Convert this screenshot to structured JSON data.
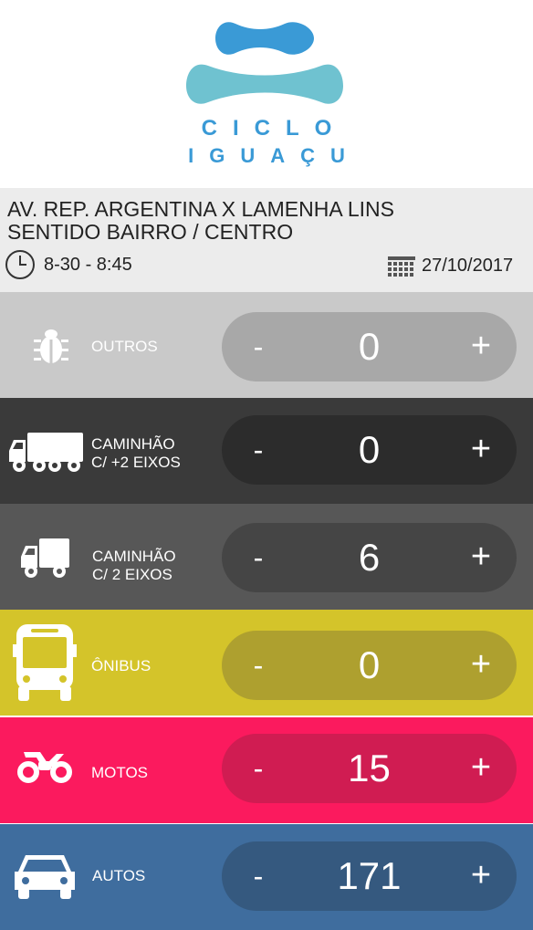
{
  "logo": {
    "line1": "CICLO",
    "line2": "IGUAÇU"
  },
  "location": {
    "line1": "AV. REP. ARGENTINA X LAMENHA LINS",
    "line2": "SENTIDO BAIRRO / CENTRO"
  },
  "time": {
    "range": "8-30 - 8:45",
    "icon": "clock-icon"
  },
  "date": {
    "value": "27/10/2017",
    "icon": "calendar-icon"
  },
  "counters": [
    {
      "label1": "OUTROS",
      "label2": "",
      "value": "0",
      "minus": "-",
      "plus": "+",
      "icon": "bug-icon",
      "bg": "#c9c9c9",
      "pill": "#a8a8a8"
    },
    {
      "label1": "CAMINHÃO",
      "label2": "C/ +2 EIXOS",
      "value": "0",
      "minus": "-",
      "plus": "+",
      "icon": "large-truck-icon",
      "bg": "#3a3a3a",
      "pill": "#2c2c2c"
    },
    {
      "label1": "CAMINHÃO",
      "label2": "C/ 2 EIXOS",
      "value": "6",
      "minus": "-",
      "plus": "+",
      "icon": "small-truck-icon",
      "bg": "#575757",
      "pill": "#454545"
    },
    {
      "label1": "ÔNIBUS",
      "label2": "",
      "value": "0",
      "minus": "-",
      "plus": "+",
      "icon": "bus-icon",
      "bg": "#d4c42a",
      "pill": "#aea02f"
    },
    {
      "label1": "MOTOS",
      "label2": "",
      "value": "15",
      "minus": "-",
      "plus": "+",
      "icon": "motorcycle-icon",
      "bg": "#fb1a5e",
      "pill": "#d01c52"
    },
    {
      "label1": "AUTOS",
      "label2": "",
      "value": "171",
      "minus": "-",
      "plus": "+",
      "icon": "car-icon",
      "bg": "#3f6d9e",
      "pill": "#35597f"
    }
  ],
  "colors": {
    "logo_dark": "#3a9ad6",
    "logo_light": "#6fc2d0",
    "info_bg": "#ececec"
  }
}
